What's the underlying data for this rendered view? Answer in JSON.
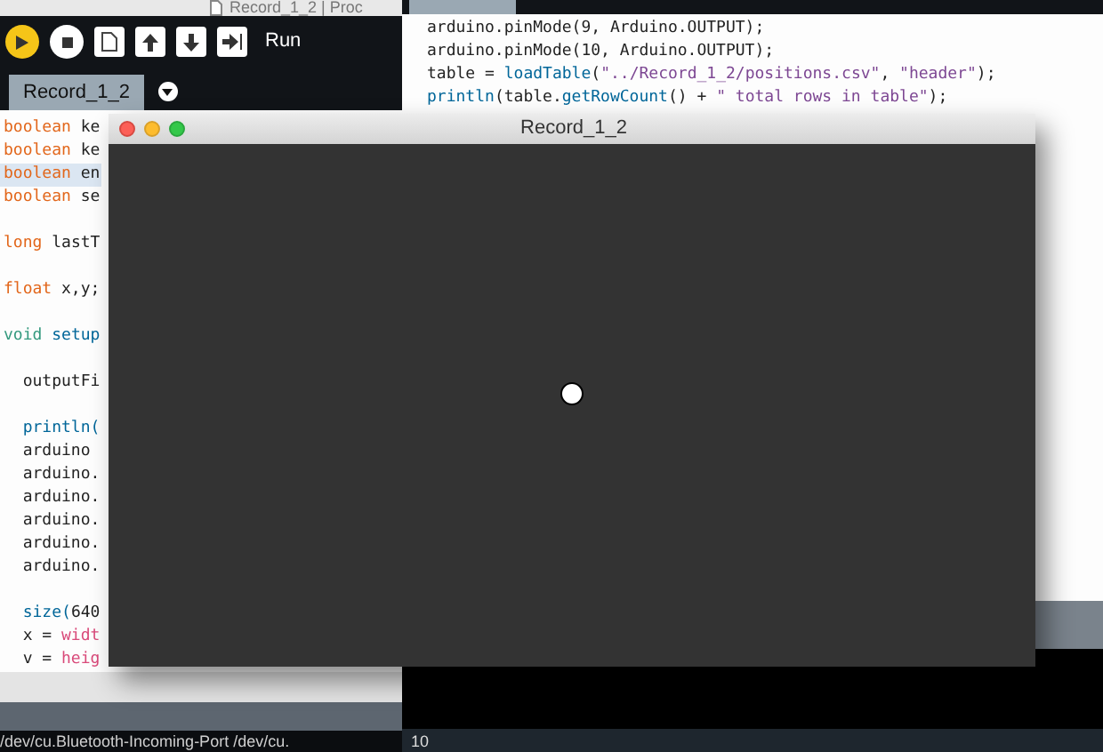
{
  "left_window": {
    "title": "Record_1_2 | Proc",
    "toolbar": {
      "run_label": "Run"
    },
    "tabs": [
      {
        "label": "Record_1_2",
        "selected": true
      }
    ],
    "code_lines": [
      {
        "kind": "code",
        "highlighted": false,
        "tokens": [
          {
            "text": "boolean",
            "kind": "type"
          },
          {
            "text": " ke",
            "kind": "plain"
          }
        ]
      },
      {
        "kind": "code",
        "highlighted": false,
        "tokens": [
          {
            "text": "boolean",
            "kind": "type"
          },
          {
            "text": " ke",
            "kind": "plain"
          }
        ]
      },
      {
        "kind": "code",
        "highlighted": true,
        "tokens": [
          {
            "text": "boolean",
            "kind": "type"
          },
          {
            "text": " en",
            "kind": "plain"
          }
        ]
      },
      {
        "kind": "code",
        "highlighted": false,
        "tokens": [
          {
            "text": "boolean",
            "kind": "type"
          },
          {
            "text": " se",
            "kind": "plain"
          }
        ]
      },
      {
        "kind": "blank"
      },
      {
        "kind": "code",
        "highlighted": false,
        "tokens": [
          {
            "text": "long",
            "kind": "type"
          },
          {
            "text": " lastT",
            "kind": "plain"
          }
        ]
      },
      {
        "kind": "blank"
      },
      {
        "kind": "code",
        "highlighted": false,
        "tokens": [
          {
            "text": "float",
            "kind": "type"
          },
          {
            "text": " x,y;",
            "kind": "plain"
          }
        ]
      },
      {
        "kind": "blank"
      },
      {
        "kind": "code",
        "highlighted": false,
        "tokens": [
          {
            "text": "void",
            "kind": "keyword"
          },
          {
            "text": " setup",
            "kind": "function"
          }
        ]
      },
      {
        "kind": "blank"
      },
      {
        "kind": "code",
        "highlighted": false,
        "tokens": [
          {
            "text": "  outputFi",
            "kind": "plain"
          }
        ]
      },
      {
        "kind": "blank"
      },
      {
        "kind": "code",
        "highlighted": false,
        "tokens": [
          {
            "text": "  println(",
            "kind": "function"
          }
        ]
      },
      {
        "kind": "code",
        "highlighted": false,
        "tokens": [
          {
            "text": "  arduino",
            "kind": "plain"
          }
        ]
      },
      {
        "kind": "code",
        "highlighted": false,
        "tokens": [
          {
            "text": "  arduino.",
            "kind": "plain"
          }
        ]
      },
      {
        "kind": "code",
        "highlighted": false,
        "tokens": [
          {
            "text": "  arduino.",
            "kind": "plain"
          }
        ]
      },
      {
        "kind": "code",
        "highlighted": false,
        "tokens": [
          {
            "text": "  arduino.",
            "kind": "plain"
          }
        ]
      },
      {
        "kind": "code",
        "highlighted": false,
        "tokens": [
          {
            "text": "  arduino.",
            "kind": "plain"
          }
        ]
      },
      {
        "kind": "code",
        "highlighted": false,
        "tokens": [
          {
            "text": "  arduino.",
            "kind": "plain"
          }
        ]
      },
      {
        "kind": "blank"
      },
      {
        "kind": "code",
        "highlighted": false,
        "tokens": [
          {
            "text": "  size(",
            "kind": "function"
          },
          {
            "text": "640",
            "kind": "plain"
          }
        ]
      },
      {
        "kind": "code",
        "highlighted": false,
        "tokens": [
          {
            "text": "  x = ",
            "kind": "plain"
          },
          {
            "text": "widt",
            "kind": "constant"
          }
        ]
      },
      {
        "kind": "code",
        "highlighted": false,
        "tokens": [
          {
            "text": "  v = ",
            "kind": "plain"
          },
          {
            "text": "heig",
            "kind": "constant"
          }
        ]
      }
    ],
    "console_status": "/dev/cu.Bluetooth-Incoming-Port /dev/cu."
  },
  "right_window": {
    "code_lines": [
      {
        "kind": "code",
        "highlighted": false,
        "tokens": [
          {
            "text": "arduino.pinMode(9, Arduino.OUTPUT);",
            "kind": "plain"
          }
        ]
      },
      {
        "kind": "code",
        "highlighted": false,
        "tokens": [
          {
            "text": "arduino.pinMode(10, Arduino.OUTPUT);",
            "kind": "plain"
          }
        ]
      },
      {
        "kind": "code",
        "highlighted": false,
        "tokens": [
          {
            "text": "table = ",
            "kind": "plain"
          },
          {
            "text": "loadTable",
            "kind": "function"
          },
          {
            "text": "(",
            "kind": "plain"
          },
          {
            "text": "\"../Record_1_2/positions.csv\"",
            "kind": "string"
          },
          {
            "text": ", ",
            "kind": "plain"
          },
          {
            "text": "\"header\"",
            "kind": "string"
          },
          {
            "text": ");",
            "kind": "plain"
          }
        ]
      },
      {
        "kind": "code",
        "highlighted": false,
        "tokens": [
          {
            "text": "println",
            "kind": "function"
          },
          {
            "text": "(table.",
            "kind": "plain"
          },
          {
            "text": "getRowCount",
            "kind": "function"
          },
          {
            "text": "() + ",
            "kind": "plain"
          },
          {
            "text": "\" total rows in table\"",
            "kind": "string"
          },
          {
            "text": ");",
            "kind": "plain"
          }
        ]
      }
    ],
    "line_number": "10"
  },
  "sketch_window": {
    "title": "Record_1_2"
  }
}
